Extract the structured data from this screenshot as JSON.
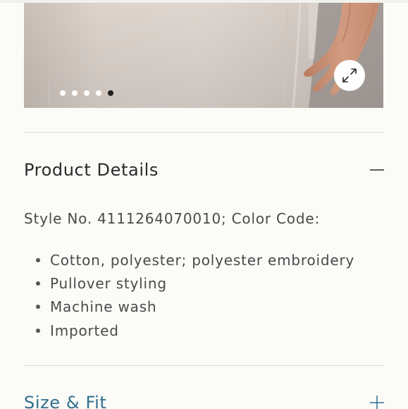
{
  "carousel": {
    "slide_count": 5,
    "active_index": 4,
    "expand_icon": "expand-arrows-icon",
    "colors": {
      "fabric": "#d8cfc8",
      "background": "#a39b97",
      "skin": "#c98f72",
      "dot_inactive": "#ffffff",
      "dot_active": "#1e1e1e"
    }
  },
  "product_details": {
    "title": "Product Details",
    "toggle_icon": "minus-icon",
    "expanded": true,
    "style_line": "Style No. 4111264070010; Color Code:",
    "bullets": [
      "Cotton, polyester; polyester embroidery",
      "Pullover styling",
      "Machine wash",
      "Imported"
    ]
  },
  "size_fit": {
    "title": "Size & Fit",
    "toggle_icon": "plus-icon",
    "expanded": false,
    "accent_color": "#2f6f8c"
  }
}
